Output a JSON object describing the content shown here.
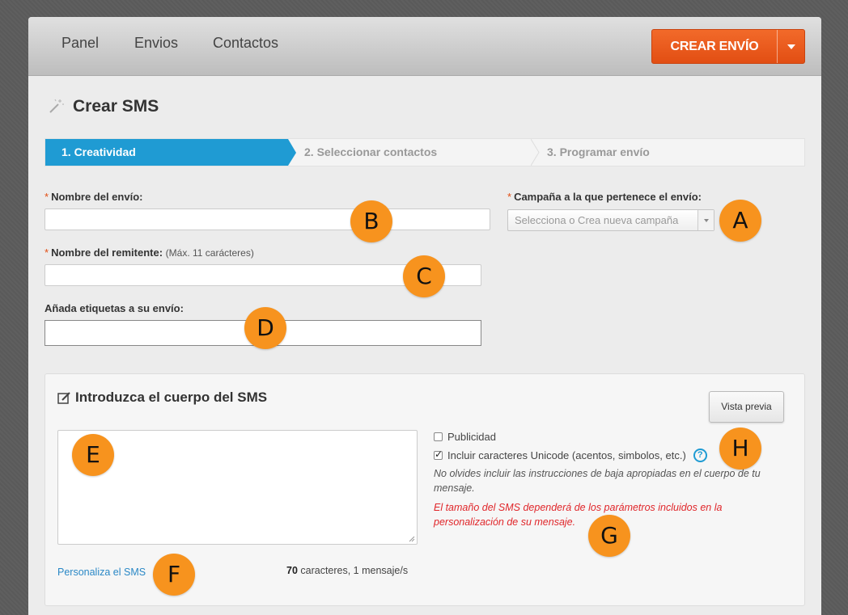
{
  "nav": {
    "items": [
      {
        "label": "Panel"
      },
      {
        "label": "Envios"
      },
      {
        "label": "Contactos"
      }
    ],
    "create_button_label": "CREAR ENVÍO"
  },
  "page": {
    "title": "Crear SMS",
    "title_icon": "magic-wand-icon"
  },
  "steps": [
    {
      "label": "1. Creatividad",
      "active": true
    },
    {
      "label": "2. Seleccionar contactos",
      "active": false
    },
    {
      "label": "3. Programar envío",
      "active": false
    }
  ],
  "form": {
    "name": {
      "required_mark": "*",
      "label": "Nombre del envío:",
      "value": ""
    },
    "sender": {
      "required_mark": "*",
      "label": "Nombre del remitente:",
      "hint": "(Máx. 11 carácteres)",
      "value": ""
    },
    "tags": {
      "label": "Añada etiquetas a su envío:",
      "value": ""
    },
    "campaign": {
      "required_mark": "*",
      "label": "Campaña a la que pertenece el envío:",
      "placeholder": "Selecciona o Crea nueva campaña"
    }
  },
  "sms_panel": {
    "title": "Introduzca el cuerpo del SMS",
    "title_icon": "edit-icon",
    "preview_button_label": "Vista previa",
    "body_value": "",
    "options": [
      {
        "label": "Publicidad",
        "checked": false
      },
      {
        "label": "Incluir caracteres Unicode (acentos, simbolos, etc.)",
        "checked": true
      }
    ],
    "help_icon_glyph": "?",
    "note_unsubscribe": "No olvides incluir las instrucciones de baja apropiadas en el cuerpo de tu mensaje.",
    "note_size": "El tamaño del SMS dependerá de los parámetros incluidos en la personalización de su mensaje.",
    "personalize_link": "Personaliza el SMS",
    "counter_count": "70",
    "counter_text": " caracteres, 1 mensaje/s"
  },
  "markers": [
    "A",
    "B",
    "C",
    "D",
    "E",
    "F",
    "G",
    "H"
  ],
  "colors": {
    "accent_blue": "#1f9bd3",
    "create_orange": "#e24e13",
    "marker_orange": "#f7931e",
    "warning_red": "#e0262a",
    "link_blue": "#2a88c6"
  }
}
